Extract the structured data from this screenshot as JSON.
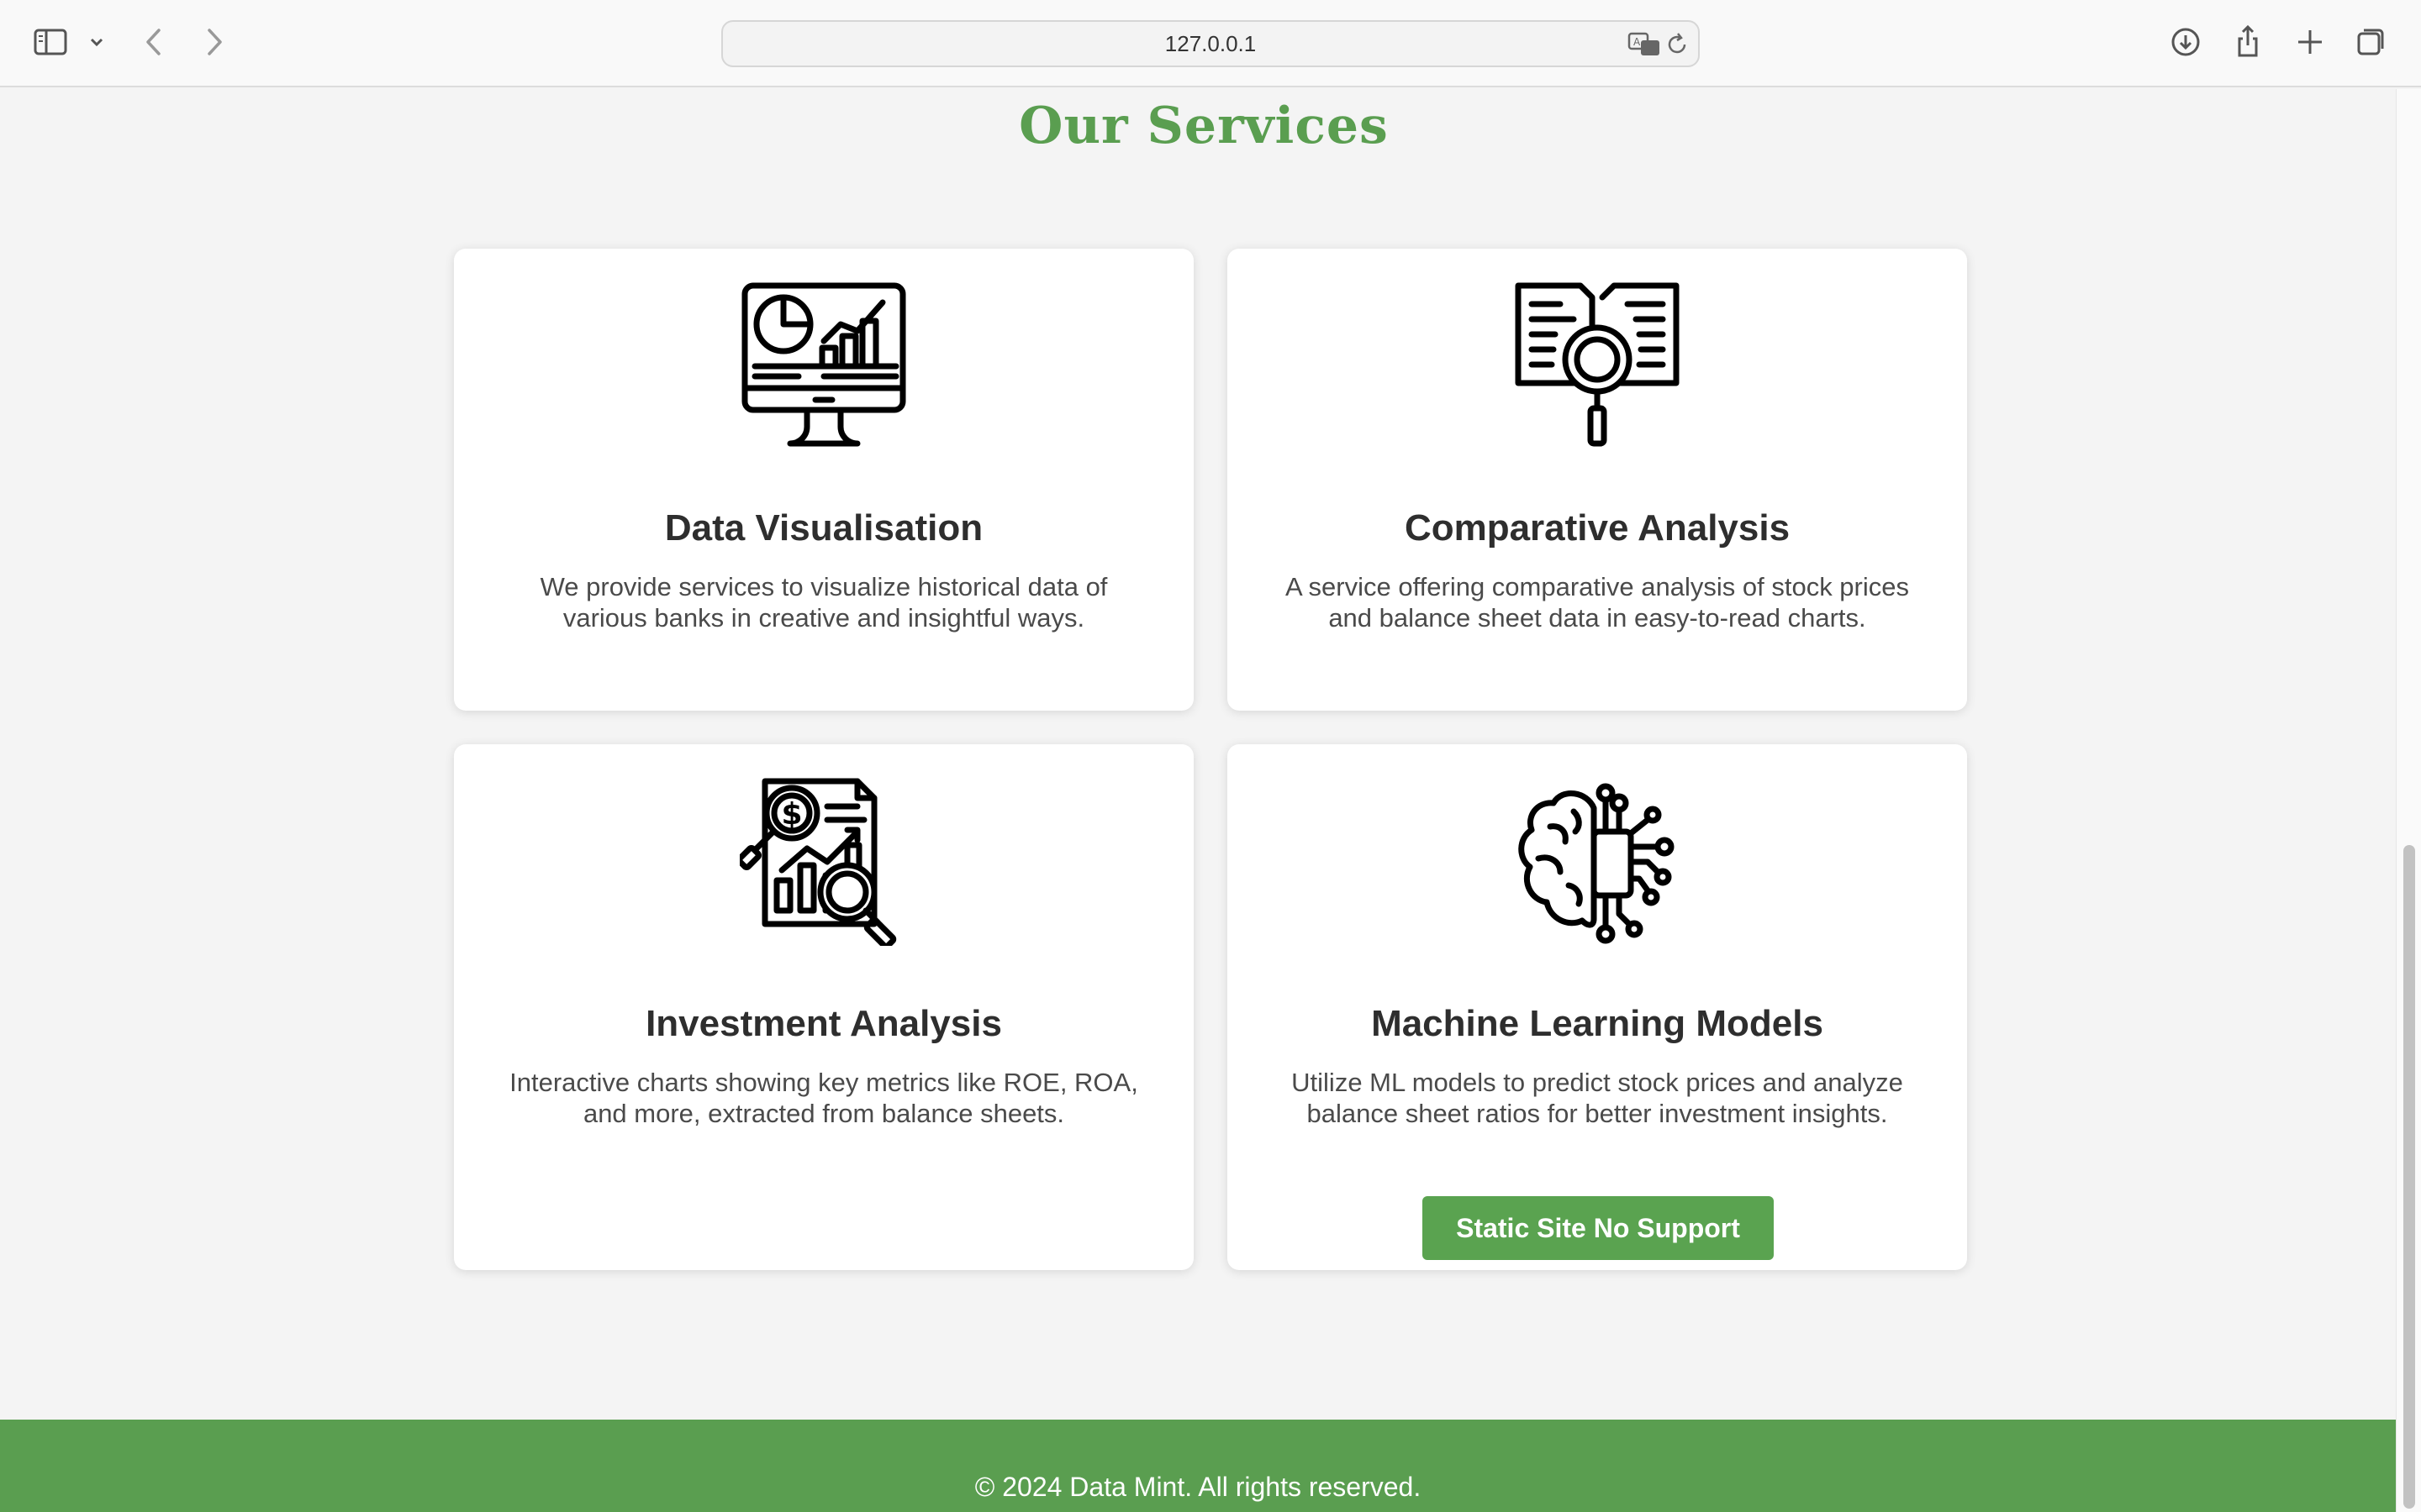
{
  "browser": {
    "url": "127.0.0.1",
    "icons": [
      "sidebar-icon",
      "chevron-down-icon",
      "back-icon",
      "forward-icon",
      "translate-icon",
      "reload-icon",
      "download-icon",
      "share-icon",
      "new-tab-icon",
      "tabs-overview-icon"
    ]
  },
  "services": {
    "title": "Our Services",
    "cards": [
      {
        "title": "Data Visualisation",
        "description": "We provide services to visualize historical data of various banks in creative and insightful ways.",
        "icon": "monitor-charts-icon"
      },
      {
        "title": "Comparative Analysis",
        "description": "A service offering comparative analysis of stock prices and balance sheet data in easy-to-read charts.",
        "icon": "documents-magnifier-icon"
      },
      {
        "title": "Investment Analysis",
        "description": "Interactive charts showing key metrics like ROE, ROA, and more, extracted from balance sheets.",
        "icon": "report-dollar-magnifier-icon"
      },
      {
        "title": "Machine Learning Models",
        "description": "Utilize ML models to predict stock prices and analyze balance sheet ratios for better investment insights.",
        "icon": "brain-circuit-icon",
        "button_label": "Static Site No Support"
      }
    ]
  },
  "footer": {
    "copyright": "© 2024 Data Mint. All rights reserved."
  },
  "colors": {
    "accent": "#5a9e50",
    "button": "#5aa350",
    "card_title": "#2e2e2e",
    "text": "#4a4a4a"
  }
}
